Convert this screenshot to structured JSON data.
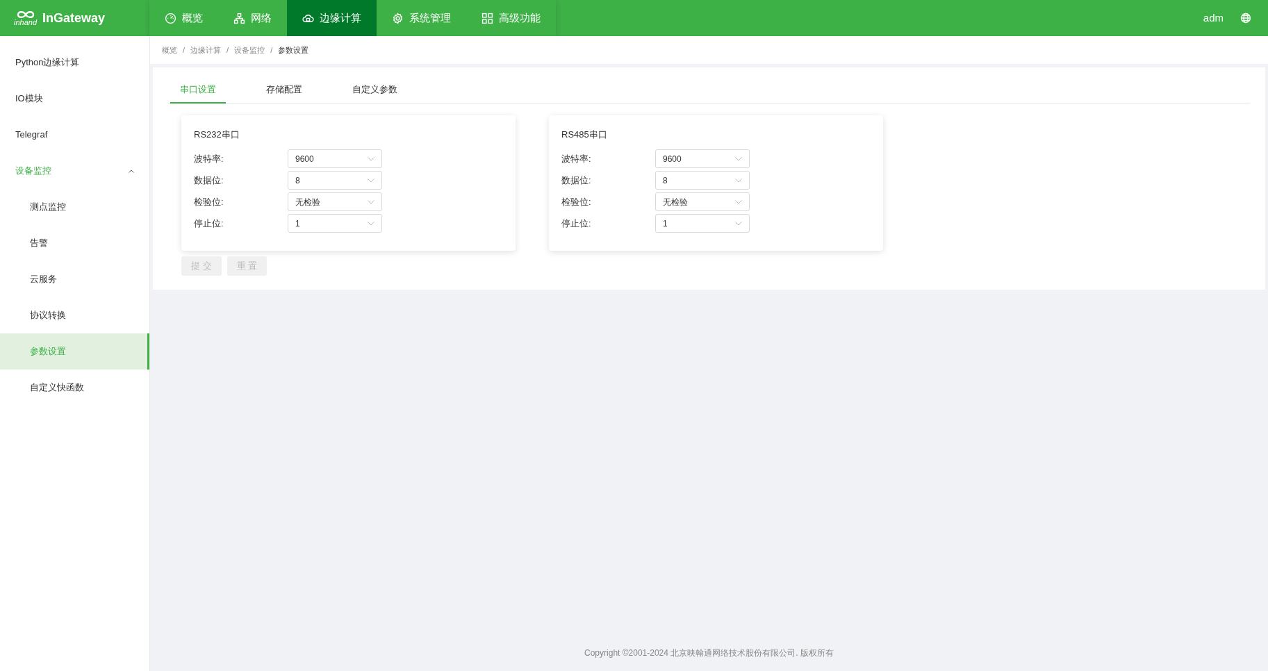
{
  "header": {
    "logo_mark": "inhand",
    "logo_text": "InGateway",
    "nav": [
      {
        "label": "概览",
        "kind": "gauge",
        "selected": false
      },
      {
        "label": "网络",
        "kind": "network",
        "selected": false
      },
      {
        "label": "边缘计算",
        "kind": "cloud",
        "selected": true
      },
      {
        "label": "系统管理",
        "kind": "gear",
        "selected": false
      },
      {
        "label": "高级功能",
        "kind": "grid",
        "selected": false
      }
    ],
    "user": "adm"
  },
  "sidebar": {
    "items": [
      {
        "label": "Python边缘计算",
        "selected": false
      },
      {
        "label": "IO模块",
        "selected": false
      },
      {
        "label": "Telegraf",
        "selected": false
      },
      {
        "label": "设备监控",
        "selected": false,
        "expanded": true,
        "children": [
          {
            "label": "测点监控",
            "selected": false
          },
          {
            "label": "告警",
            "selected": false
          },
          {
            "label": "云服务",
            "selected": false
          },
          {
            "label": "协议转换",
            "selected": false
          },
          {
            "label": "参数设置",
            "selected": true
          },
          {
            "label": "自定义快函数",
            "selected": false
          }
        ]
      }
    ]
  },
  "breadcrumb": [
    {
      "label": "概览"
    },
    {
      "separator": "/",
      "label": "边缘计算"
    },
    {
      "separator": "/",
      "label": "设备监控"
    },
    {
      "separator": "/",
      "label": "参数设置"
    }
  ],
  "tabs": [
    {
      "label": "串口设置",
      "selected": true
    },
    {
      "label": "存储配置",
      "selected": false
    },
    {
      "label": "自定义参数",
      "selected": false
    }
  ],
  "cards": [
    {
      "title": "RS232串口",
      "fields": [
        {
          "label": "波特率:",
          "value": "9600"
        },
        {
          "label": "数据位:",
          "value": "8"
        },
        {
          "label": "检验位:",
          "value": "无检验"
        },
        {
          "label": "停止位:",
          "value": "1"
        }
      ]
    },
    {
      "title": "RS485串口",
      "fields": [
        {
          "label": "波特率:",
          "value": "9600"
        },
        {
          "label": "数据位:",
          "value": "8"
        },
        {
          "label": "检验位:",
          "value": "无检验"
        },
        {
          "label": "停止位:",
          "value": "1"
        }
      ]
    }
  ],
  "buttons": [
    {
      "label": "提 交",
      "disabled": true
    },
    {
      "label": "重 置",
      "disabled": true
    }
  ],
  "footer": "Copyright ©2001-2024 北京映翰通网络技术股份有限公司. 版权所有"
}
